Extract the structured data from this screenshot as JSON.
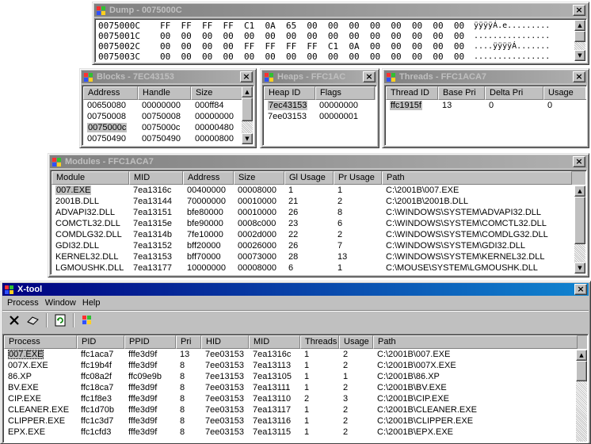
{
  "dump": {
    "title": "Dump - 0075000C",
    "lines": [
      {
        "addr": "0075000C",
        "hex": "FF  FF  FF  FF  C1  0A  65  00  00  00  00  00  00  00  00  00",
        "ascii": "ÿÿÿÿÁ.e........."
      },
      {
        "addr": "0075001C",
        "hex": "00  00  00  00  00  00  00  00  00  00  00  00  00  00  00  00",
        "ascii": "................"
      },
      {
        "addr": "0075002C",
        "hex": "00  00  00  00  FF  FF  FF  FF  C1  0A  00  00  00  00  00  00",
        "ascii": "....ÿÿÿÿÁ......."
      },
      {
        "addr": "0075003C",
        "hex": "00  00  00  00  00  00  00  00  00  00  00  00  00  00  00  00",
        "ascii": "................"
      }
    ]
  },
  "blocks": {
    "title": "Blocks - 7EC43153",
    "headers": [
      "Address",
      "Handle",
      "Size"
    ],
    "rows": [
      [
        "00650080",
        "00000000",
        "000ff84"
      ],
      [
        "00750008",
        "00750008",
        "00000000"
      ],
      [
        "0075000c",
        "0075000c",
        "00000480"
      ],
      [
        "00750490",
        "00750490",
        "00000800"
      ]
    ]
  },
  "heaps": {
    "title": "Heaps - FFC1AC",
    "headers": [
      "Heap ID",
      "Flags"
    ],
    "rows": [
      [
        "7ec43153",
        "00000000"
      ],
      [
        "7ee03153",
        "00000001"
      ]
    ]
  },
  "threads": {
    "title": "Threads - FFC1ACA7",
    "headers": [
      "Thread ID",
      "Base Pri",
      "Delta Pri",
      "Usage"
    ],
    "rows": [
      [
        "ffc1915f",
        "13",
        "0",
        "0"
      ]
    ]
  },
  "modules": {
    "title": "Modules - FFC1ACA7",
    "headers": [
      "Module",
      "MID",
      "Address",
      "Size",
      "Gl Usage",
      "Pr Usage",
      "Path"
    ],
    "rows": [
      [
        "007.EXE",
        "7ea1316c",
        "00400000",
        "00008000",
        "1",
        "1",
        "C:\\2001B\\007.EXE"
      ],
      [
        "2001B.DLL",
        "7ea13144",
        "70000000",
        "00010000",
        "21",
        "2",
        "C:\\2001B\\2001B.DLL"
      ],
      [
        "ADVAPI32.DLL",
        "7ea13151",
        "bfe80000",
        "00010000",
        "26",
        "8",
        "C:\\WINDOWS\\SYSTEM\\ADVAPI32.DLL"
      ],
      [
        "COMCTL32.DLL",
        "7ea1315e",
        "bfe90000",
        "0008c000",
        "23",
        "6",
        "C:\\WINDOWS\\SYSTEM\\COMCTL32.DLL"
      ],
      [
        "COMDLG32.DLL",
        "7ea1314b",
        "7fe10000",
        "0002d000",
        "22",
        "2",
        "C:\\WINDOWS\\SYSTEM\\COMDLG32.DLL"
      ],
      [
        "GDI32.DLL",
        "7ea13152",
        "bff20000",
        "00026000",
        "26",
        "7",
        "C:\\WINDOWS\\SYSTEM\\GDI32.DLL"
      ],
      [
        "KERNEL32.DLL",
        "7ea13153",
        "bff70000",
        "00073000",
        "28",
        "13",
        "C:\\WINDOWS\\SYSTEM\\KERNEL32.DLL"
      ],
      [
        "LGMOUSHK.DLL",
        "7ea13177",
        "10000000",
        "00008000",
        "6",
        "1",
        "C:\\MOUSE\\SYSTEM\\LGMOUSHK.DLL"
      ]
    ]
  },
  "xtool": {
    "title": "X-tool",
    "menu": [
      "Process",
      "Window",
      "Help"
    ],
    "headers": [
      "Process",
      "PID",
      "PPID",
      "Pri",
      "HID",
      "MID",
      "Threads",
      "Usage",
      "Path"
    ],
    "rows": [
      [
        "007.EXE",
        "ffc1aca7",
        "fffe3d9f",
        "13",
        "7ee03153",
        "7ea1316c",
        "1",
        "2",
        "C:\\2001B\\007.EXE"
      ],
      [
        "007X.EXE",
        "ffc19b4f",
        "fffe3d9f",
        "8",
        "7ee03153",
        "7ea13113",
        "1",
        "2",
        "C:\\2001B\\007X.EXE"
      ],
      [
        "86.XP",
        "ffc08a2f",
        "ffc09e9b",
        "8",
        "7ee13153",
        "7ea13105",
        "1",
        "1",
        "C:\\2001B\\86.XP"
      ],
      [
        "BV.EXE",
        "ffc18ca7",
        "fffe3d9f",
        "8",
        "7ee03153",
        "7ea13111",
        "1",
        "2",
        "C:\\2001B\\BV.EXE"
      ],
      [
        "CIP.EXE",
        "ffc1f8e3",
        "fffe3d9f",
        "8",
        "7ee03153",
        "7ea13110",
        "2",
        "3",
        "C:\\2001B\\CIP.EXE"
      ],
      [
        "CLEANER.EXE",
        "ffc1d70b",
        "fffe3d9f",
        "8",
        "7ee03153",
        "7ea13117",
        "1",
        "2",
        "C:\\2001B\\CLEANER.EXE"
      ],
      [
        "CLIPPER.EXE",
        "ffc1c3d7",
        "fffe3d9f",
        "8",
        "7ee03153",
        "7ea13116",
        "1",
        "2",
        "C:\\2001B\\CLIPPER.EXE"
      ],
      [
        "EPX.EXE",
        "ffc1cfd3",
        "fffe3d9f",
        "8",
        "7ee03153",
        "7ea13115",
        "1",
        "2",
        "C:\\2001B\\EPX.EXE"
      ]
    ]
  },
  "close_glyph": "×",
  "colors": {
    "active_title": "#000080",
    "inactive_title": "#808080",
    "face": "#c0c0c0"
  }
}
